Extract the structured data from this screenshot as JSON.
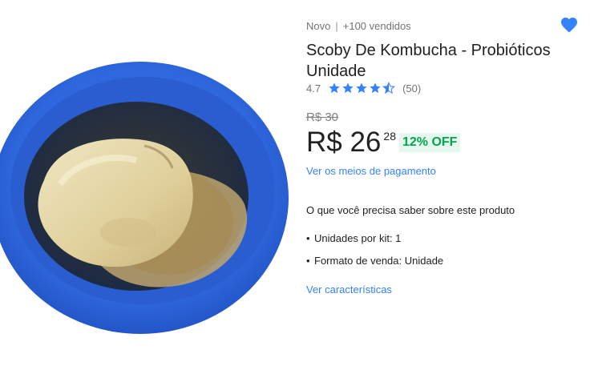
{
  "product": {
    "image_alt": "Scoby de kombucha em tigela azul",
    "condition": "Novo",
    "sold": "+100 vendidos",
    "title": "Scoby De Kombucha - Probióticos Unidade",
    "rating": {
      "score": "4.7",
      "stars": 4.5,
      "count": "(50)"
    },
    "old_price": "R$ 30",
    "price": {
      "main": "R$ 26",
      "cents": "28"
    },
    "discount": "12% OFF",
    "payment_link": "Ver os meios de pagamento",
    "section_title": "O que você precisa saber sobre este produto",
    "features": [
      {
        "bullet": "•",
        "text": "Unidades por kit: 1"
      },
      {
        "bullet": "•",
        "text": "Formato de venda: Unidade"
      }
    ],
    "characteristics_link": "Ver características"
  },
  "icons": {
    "favorite": "heart-icon",
    "star": "star-icon"
  },
  "colors": {
    "accent": "#3483fa",
    "discount": "#00a650",
    "bowl": "#3b6fe0"
  }
}
